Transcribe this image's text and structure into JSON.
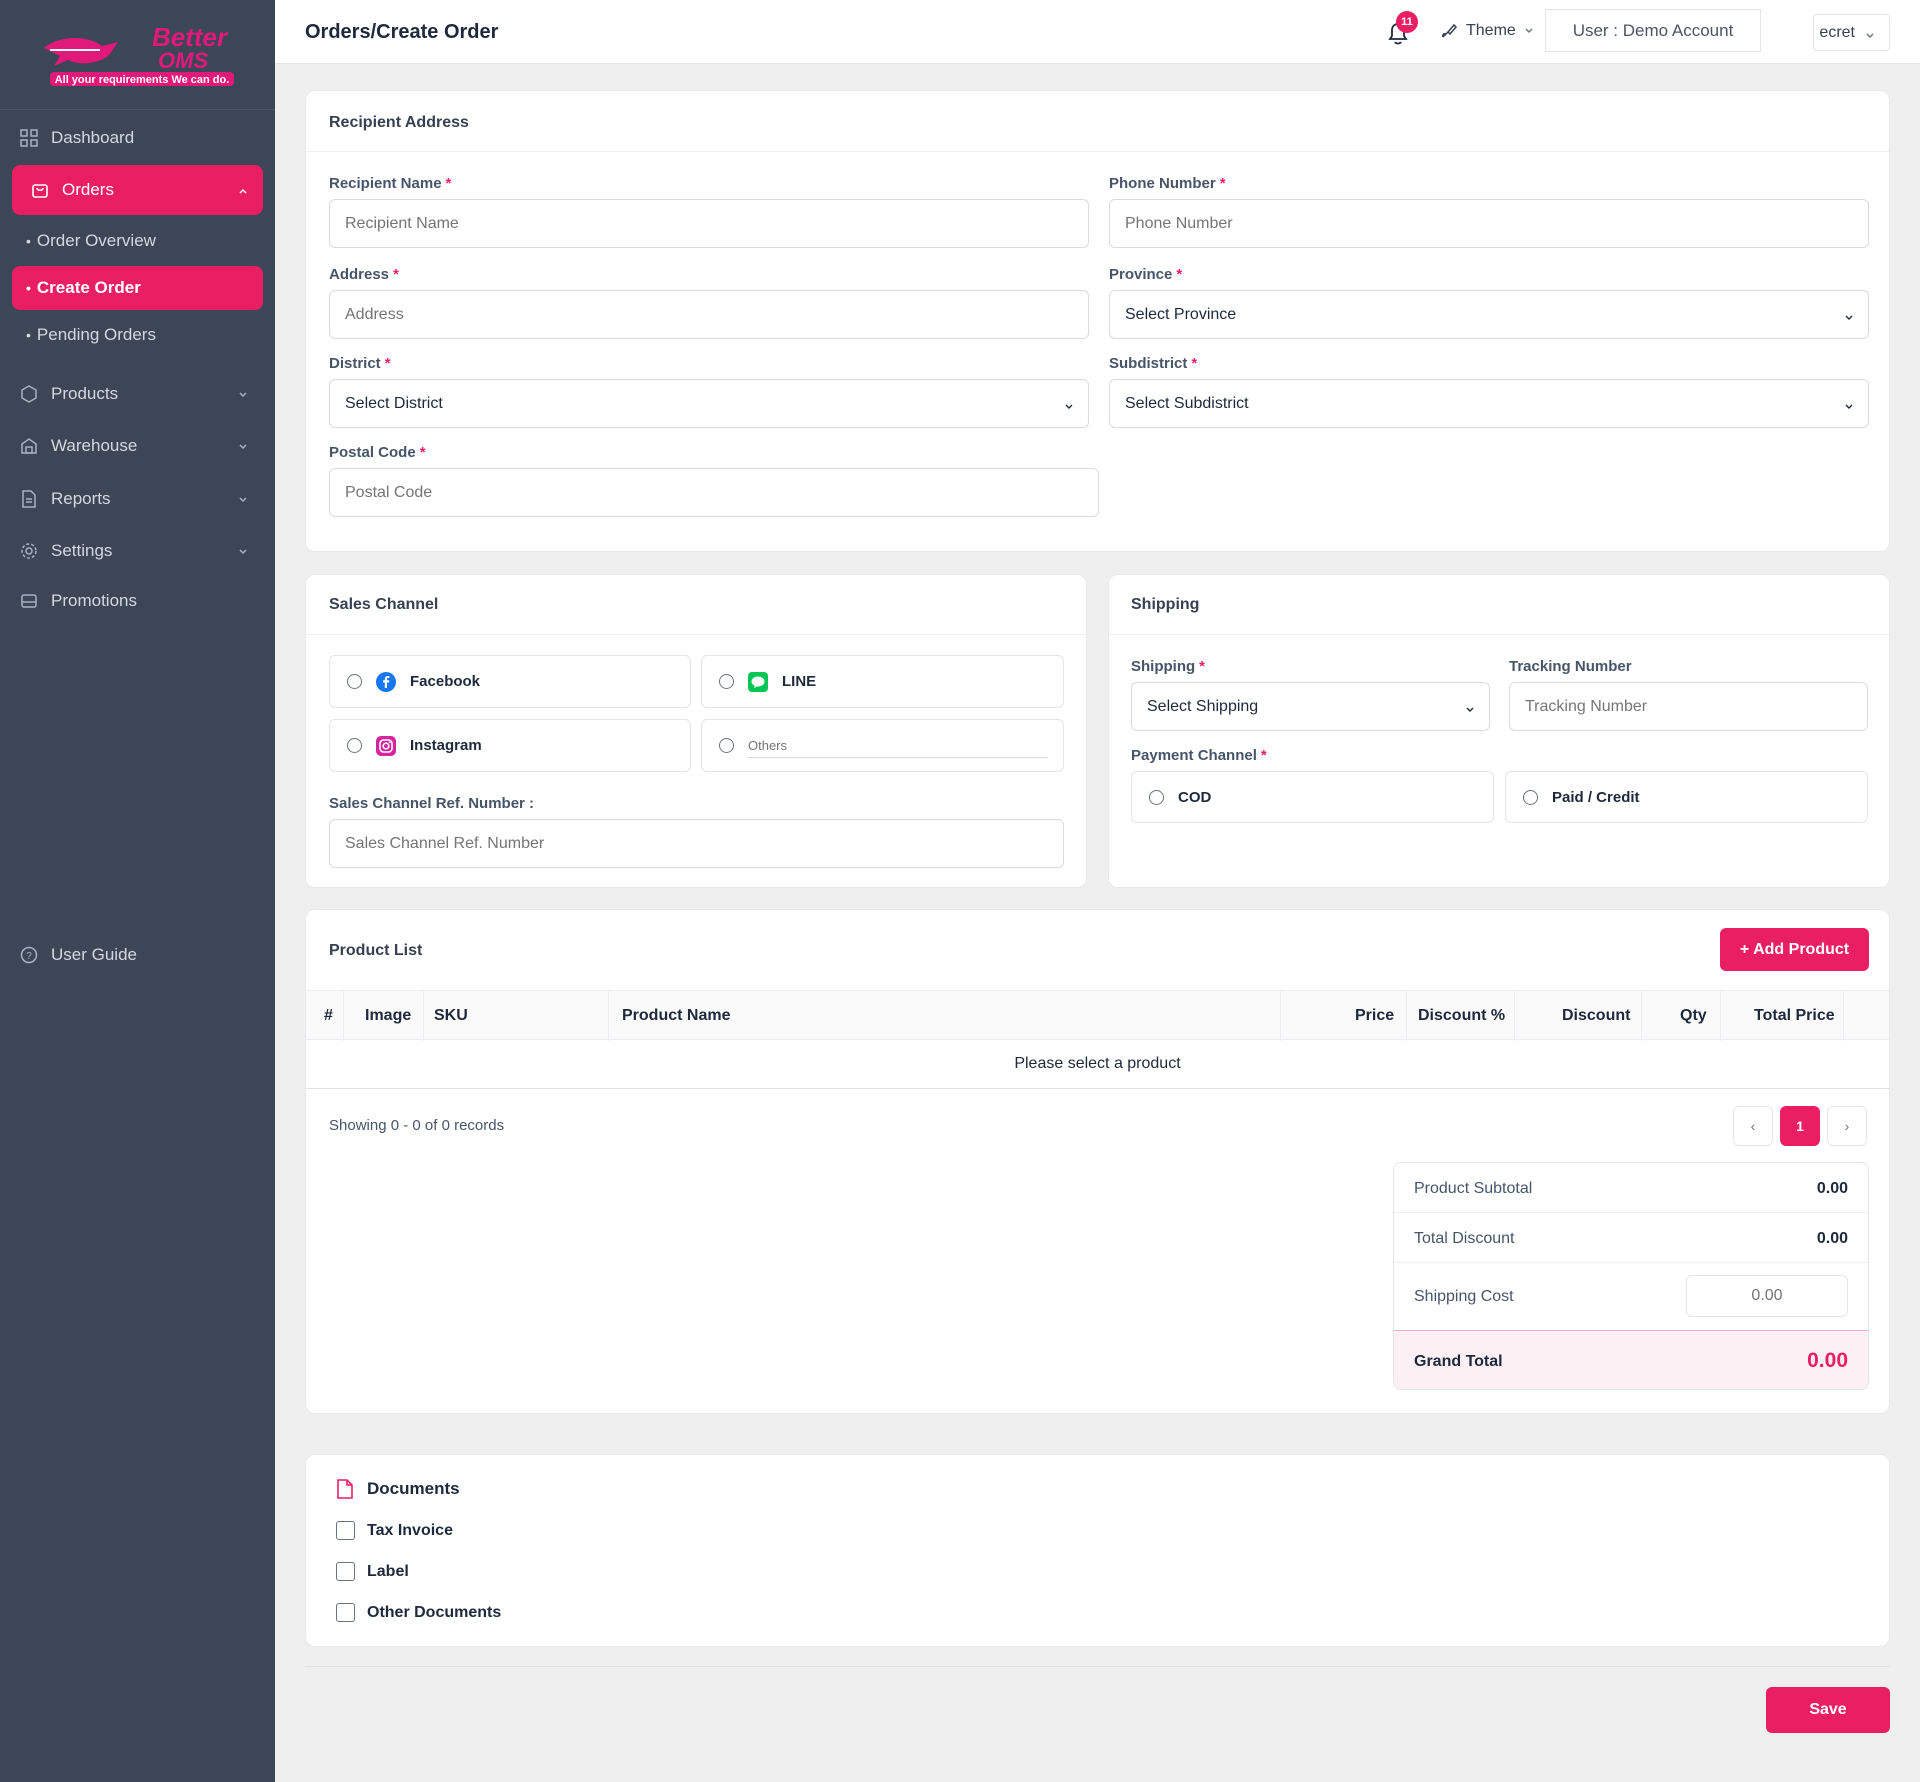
{
  "brand": {
    "name_line1": "Better",
    "name_line2": "OMS",
    "tagline": "All your requirements We can do."
  },
  "sidebar": {
    "dashboard": "Dashboard",
    "orders": "Orders",
    "order_overview": "Order Overview",
    "create_order": "Create Order",
    "pending_orders": "Pending Orders",
    "products": "Products",
    "warehouse": "Warehouse",
    "reports": "Reports",
    "settings": "Settings",
    "promotions": "Promotions",
    "user_guide": "User Guide"
  },
  "header": {
    "title": "Orders/Create Order",
    "notification_count": "11",
    "theme_label": "Theme",
    "user_label": "User : Demo Account",
    "secret_label": "ecret"
  },
  "recipient": {
    "title": "Recipient Address",
    "name_label": "Recipient Name",
    "name_placeholder": "Recipient Name",
    "phone_label": "Phone Number",
    "phone_placeholder": "Phone Number",
    "address_label": "Address",
    "address_placeholder": "Address",
    "province_label": "Province",
    "province_value": "Select Province",
    "district_label": "District",
    "district_value": "Select District",
    "subdistrict_label": "Subdistrict",
    "subdistrict_value": "Select Subdistrict",
    "postal_label": "Postal Code",
    "postal_placeholder": "Postal Code",
    "required_mark": "*"
  },
  "sales_channel": {
    "title": "Sales Channel",
    "facebook": "Facebook",
    "line": "LINE",
    "instagram": "Instagram",
    "others_placeholder": "Others",
    "ref_label": "Sales Channel Ref. Number :",
    "ref_placeholder": "Sales Channel Ref. Number"
  },
  "shipping": {
    "title": "Shipping",
    "shipping_label": "Shipping",
    "shipping_value": "Select Shipping",
    "tracking_label": "Tracking Number",
    "tracking_placeholder": "Tracking Number",
    "payment_label": "Payment Channel",
    "cod": "COD",
    "paid": "Paid / Credit"
  },
  "products": {
    "title": "Product List",
    "add_button": "+ Add Product",
    "columns": [
      "#",
      "Image",
      "SKU",
      "Product Name",
      "Price",
      "Discount %",
      "Discount",
      "Qty",
      "Total Price"
    ],
    "empty": "Please select a product",
    "showing": "Showing 0 - 0 of 0 records",
    "page_prev": "‹",
    "page_current": "1",
    "page_next": "›"
  },
  "summary": {
    "subtotal_label": "Product Subtotal",
    "subtotal_value": "0.00",
    "discount_label": "Total Discount",
    "discount_value": "0.00",
    "shipping_label": "Shipping Cost",
    "shipping_placeholder": "0.00",
    "grand_label": "Grand Total",
    "grand_value": "0.00"
  },
  "documents": {
    "title": "Documents",
    "tax_invoice": "Tax Invoice",
    "label": "Label",
    "other": "Other Documents"
  },
  "save_label": "Save",
  "colors": {
    "accent": "#ea1f63",
    "sidebar_bg": "#3c4656",
    "facebook": "#1877f2",
    "line": "#06c755"
  }
}
